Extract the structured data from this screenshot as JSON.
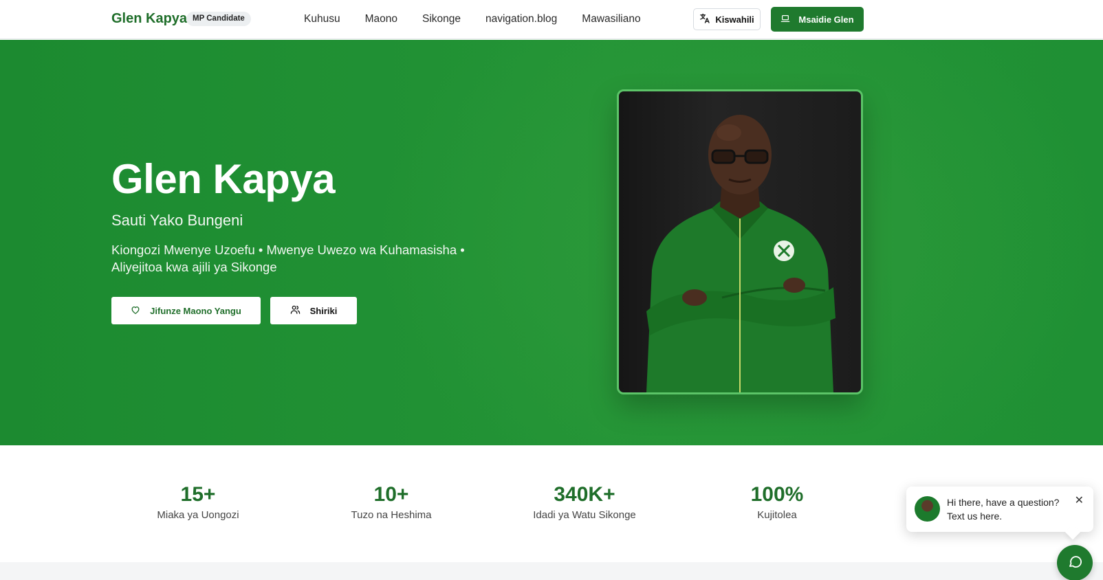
{
  "header": {
    "brand": "Glen Kapya",
    "badge": "MP Candidate",
    "nav": [
      "Kuhusu",
      "Maono",
      "Sikonge",
      "navigation.blog",
      "Mawasiliano"
    ],
    "language_label": "Kiswahili",
    "support_label": "Msaidie Glen"
  },
  "hero": {
    "title": "Glen Kapya",
    "subtitle": "Sauti Yako Bungeni",
    "description": "Kiongozi Mwenye Uzoefu • Mwenye Uwezo wa Kuhamasisha • Aliyejitoa kwa ajili ya Sikonge",
    "primary_button": "Jifunze Maono Yangu",
    "secondary_button": "Shiriki"
  },
  "stats": [
    {
      "value": "15+",
      "label": "Miaka ya Uongozi"
    },
    {
      "value": "10+",
      "label": "Tuzo na Heshima"
    },
    {
      "value": "340K+",
      "label": "Idadi ya Watu Sikonge"
    },
    {
      "value": "100%",
      "label": "Kujitolea"
    }
  ],
  "chat": {
    "message": "Hi there, have a question? Text us here.",
    "close_symbol": "✕"
  },
  "colors": {
    "brand_green": "#1f7a2e",
    "hero_green": "#239436",
    "portrait_border": "#5cc468"
  }
}
